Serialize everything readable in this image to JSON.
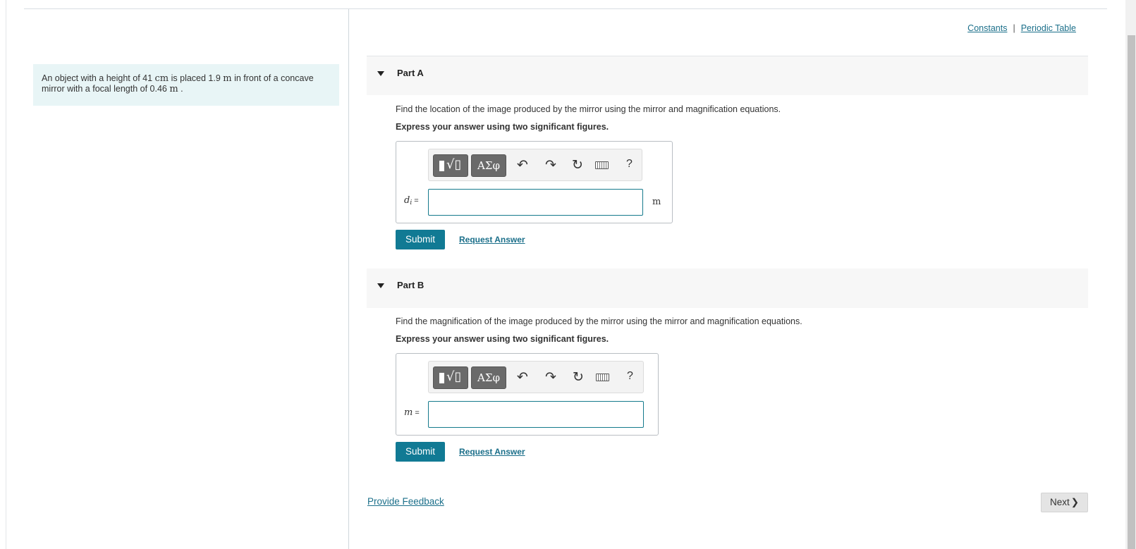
{
  "top_links": {
    "constants": "Constants",
    "separator": "|",
    "periodic_table": "Periodic Table"
  },
  "problem": {
    "text_1": "An object with a height of 41 ",
    "unit_cm": "cm",
    "text_2": " is placed 1.9 ",
    "unit_m1": "m",
    "text_3": " in front of a concave mirror with a focal length of 0.46 ",
    "unit_m2": "m",
    "text_4": " ."
  },
  "part_a": {
    "title": "Part A",
    "instruction": "Find the location of the image produced by the mirror using the mirror and magnification equations.",
    "emphasis": "Express your answer using two significant figures.",
    "toolbar": {
      "greek_label": "ΑΣφ",
      "undo": "↶",
      "redo": "↷",
      "reset": "↻",
      "help": "?"
    },
    "var": "d",
    "var_sub": "i",
    "equals": "=",
    "answer_value": "",
    "unit": "m",
    "submit_label": "Submit",
    "request_label": "Request Answer"
  },
  "part_b": {
    "title": "Part B",
    "instruction": "Find the magnification of the image produced by the mirror using the mirror and magnification equations.",
    "emphasis": "Express your answer using two significant figures.",
    "toolbar": {
      "greek_label": "ΑΣφ",
      "undo": "↶",
      "redo": "↷",
      "reset": "↻",
      "help": "?"
    },
    "var": "m",
    "equals": "=",
    "answer_value": "",
    "submit_label": "Submit",
    "request_label": "Request Answer"
  },
  "footer": {
    "feedback_label": "Provide Feedback",
    "next_label": "Next",
    "next_chevron": "❯"
  },
  "colors": {
    "accent": "#117a94",
    "link": "#1b6f8a",
    "problem_bg": "#e8f5f6",
    "input_border": "#157a8c"
  },
  "icons": [
    "template-icon",
    "greek-icon",
    "undo-icon",
    "redo-icon",
    "reset-icon",
    "keyboard-icon",
    "help-icon",
    "caret-down-icon",
    "chevron-right-icon"
  ]
}
